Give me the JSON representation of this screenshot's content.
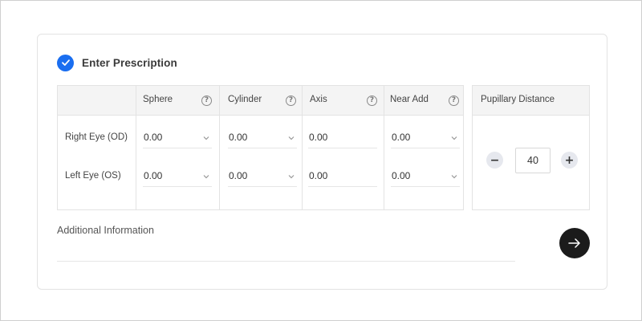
{
  "header": {
    "title": "Enter Prescription",
    "icon": "check-circle-icon",
    "accent": "#1a6ef0"
  },
  "table": {
    "columns": [
      "Sphere",
      "Cylinder",
      "Axis",
      "Near Add"
    ],
    "rows": [
      {
        "label": "Right Eye (OD)",
        "values": [
          "0.00",
          "0.00",
          "0.00",
          "0.00"
        ]
      },
      {
        "label": "Left Eye (OS)",
        "values": [
          "0.00",
          "0.00",
          "0.00",
          "0.00"
        ]
      }
    ],
    "help_glyph": "?"
  },
  "pupillary_distance": {
    "label": "Pupillary Distance",
    "value": "40",
    "decrement": "−",
    "increment": "+"
  },
  "additional_info": {
    "label": "Additional Information"
  },
  "submit": {
    "icon": "arrow-right-icon",
    "color": "#1b1b1b"
  }
}
